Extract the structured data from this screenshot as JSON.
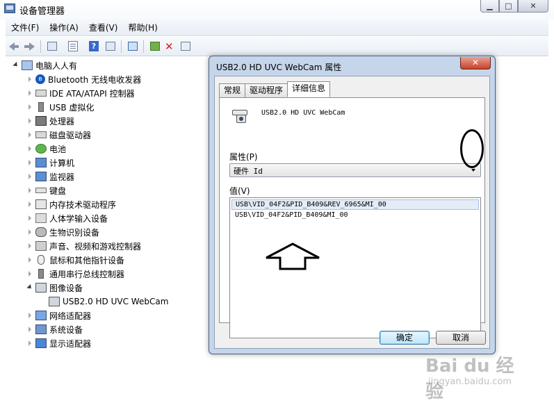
{
  "window": {
    "title": "设备管理器",
    "min_glyph": "▁",
    "max_glyph": "□",
    "close_glyph": "✕"
  },
  "menubar": [
    "文件(F)",
    "操作(A)",
    "查看(V)",
    "帮助(H)"
  ],
  "toolbar_icons": [
    "back-arrow-icon",
    "forward-arrow-icon",
    "properties-icon",
    "document-icon",
    "help-icon",
    "grid-icon",
    "scan-hardware-icon",
    "update-driver-icon",
    "uninstall-icon",
    "enable-icon"
  ],
  "tree": {
    "root": "电脑人人有",
    "categories": [
      {
        "label": "Bluetooth 无线电收发器",
        "icon": "bluetooth-icon"
      },
      {
        "label": "IDE ATA/ATAPI 控制器",
        "icon": "ide-controller-icon"
      },
      {
        "label": "USB 虚拟化",
        "icon": "usb-icon"
      },
      {
        "label": "处理器",
        "icon": "processor-icon"
      },
      {
        "label": "磁盘驱动器",
        "icon": "disk-drive-icon"
      },
      {
        "label": "电池",
        "icon": "battery-icon"
      },
      {
        "label": "计算机",
        "icon": "computer-icon"
      },
      {
        "label": "监视器",
        "icon": "monitor-icon"
      },
      {
        "label": "键盘",
        "icon": "keyboard-icon"
      },
      {
        "label": "内存技术驱动程序",
        "icon": "memory-icon"
      },
      {
        "label": "人体学输入设备",
        "icon": "hid-icon"
      },
      {
        "label": "生物识别设备",
        "icon": "biometric-icon"
      },
      {
        "label": "声音、视频和游戏控制器",
        "icon": "sound-icon"
      },
      {
        "label": "鼠标和其他指针设备",
        "icon": "mouse-icon"
      },
      {
        "label": "通用串行总线控制器",
        "icon": "usb-controller-icon"
      },
      {
        "label": "图像设备",
        "icon": "imaging-device-icon",
        "expanded": true
      },
      {
        "label": "网络适配器",
        "icon": "network-adapter-icon"
      },
      {
        "label": "系统设备",
        "icon": "system-device-icon"
      },
      {
        "label": "显示适配器",
        "icon": "display-adapter-icon"
      }
    ],
    "child": "USB2.0 HD UVC WebCam"
  },
  "dialog": {
    "title": "USB2.0 HD UVC WebCam 属性",
    "close_glyph": "✕",
    "tabs": [
      "常规",
      "驱动程序",
      "详细信息"
    ],
    "active_tab": "详细信息",
    "device_name": "USB2.0 HD UVC WebCam",
    "property_label": "属性(P)",
    "property_value": "硬件 Id",
    "value_label": "值(V)",
    "values": [
      "USB\\VID_04F2&PID_B409&REV_6965&MI_00",
      "USB\\VID_04F2&PID_B409&MI_00"
    ],
    "ok_button": "确定",
    "cancel_button": "取消"
  },
  "watermark": {
    "logo": "Bai du 经验",
    "url": "jingyan.baidu.com"
  }
}
